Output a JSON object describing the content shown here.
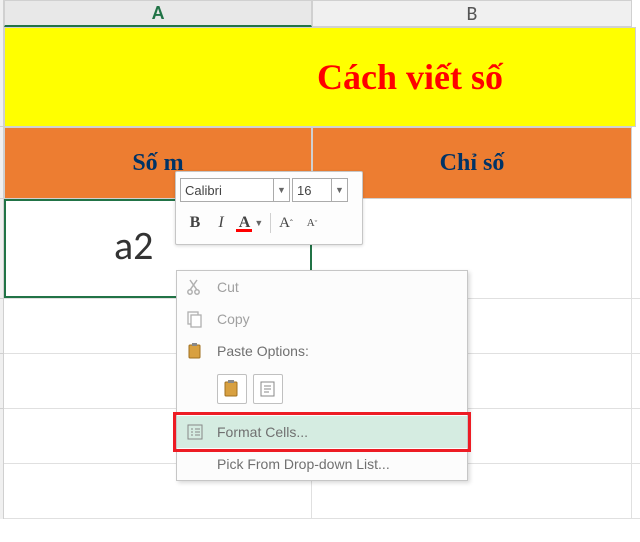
{
  "columns": {
    "a": "A",
    "b": "B"
  },
  "banner": {
    "title": "Cách viết số"
  },
  "headers": {
    "col_a": "Số m",
    "col_b": "Chỉ số"
  },
  "editing": {
    "value": "a2"
  },
  "mini_toolbar": {
    "font_name": "Calibri",
    "font_size": "16",
    "bold": "B",
    "italic": "I",
    "font_color": "A",
    "grow": "A",
    "shrink": "A"
  },
  "context_menu": {
    "cut": "Cut",
    "copy": "Copy",
    "paste_options": "Paste Options:",
    "format_cells": "Format Cells...",
    "pick_list": "Pick From Drop-down List..."
  }
}
